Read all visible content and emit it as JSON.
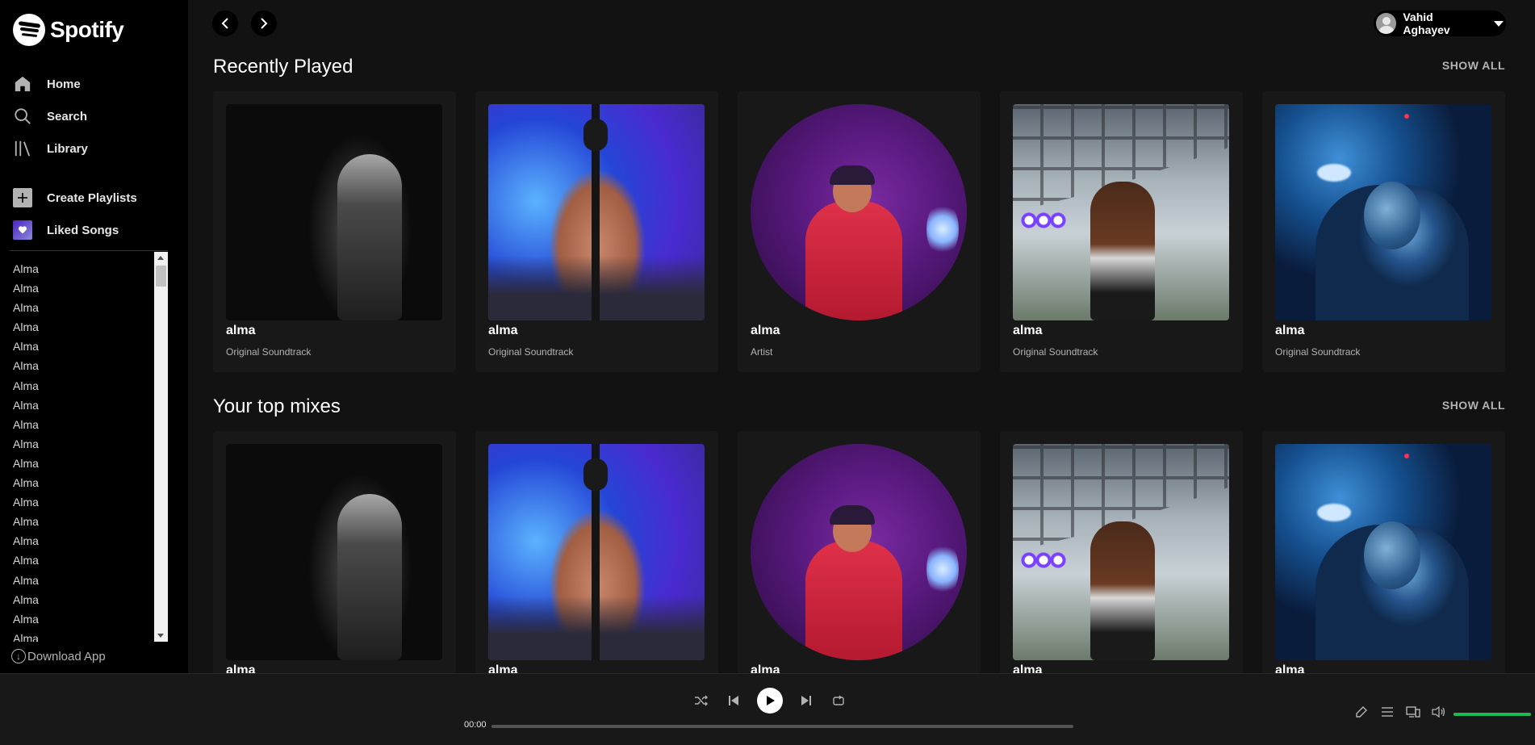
{
  "app": {
    "name": "Spotify"
  },
  "sidebar": {
    "nav": [
      {
        "label": "Home",
        "icon": "home-icon"
      },
      {
        "label": "Search",
        "icon": "search-icon"
      },
      {
        "label": "Library",
        "icon": "library-icon"
      }
    ],
    "library": [
      {
        "label": "Create Playlists",
        "icon": "plus-icon"
      },
      {
        "label": "Liked Songs",
        "icon": "heart-icon"
      }
    ],
    "playlists": [
      "Alma",
      "Alma",
      "Alma",
      "Alma",
      "Alma",
      "Alma",
      "Alma",
      "Alma",
      "Alma",
      "Alma",
      "Alma",
      "Alma",
      "Alma",
      "Alma",
      "Alma",
      "Alma",
      "Alma",
      "Alma",
      "Alma",
      "Alma"
    ],
    "download_label": "Download App"
  },
  "header": {
    "user_name": "Vahid Aghayev"
  },
  "sections": [
    {
      "title": "Recently Played",
      "show_all": "SHOW ALL",
      "cards": [
        {
          "title": "alma",
          "subtitle": "Original Soundtrack"
        },
        {
          "title": "alma",
          "subtitle": "Original Soundtrack"
        },
        {
          "title": "alma",
          "subtitle": "Artist"
        },
        {
          "title": "alma",
          "subtitle": "Original Soundtrack"
        },
        {
          "title": "alma",
          "subtitle": "Original Soundtrack"
        }
      ]
    },
    {
      "title": "Your top mixes",
      "show_all": "SHOW ALL",
      "cards": [
        {
          "title": "alma"
        },
        {
          "title": "alma"
        },
        {
          "title": "alma"
        },
        {
          "title": "alma"
        },
        {
          "title": "alma"
        }
      ]
    }
  ],
  "player": {
    "current_time": "00:00",
    "progress": 0,
    "volume": 1.0
  },
  "colors": {
    "accent": "#1db954",
    "background": "#121212",
    "sidebar": "#000000",
    "card": "#181818"
  }
}
